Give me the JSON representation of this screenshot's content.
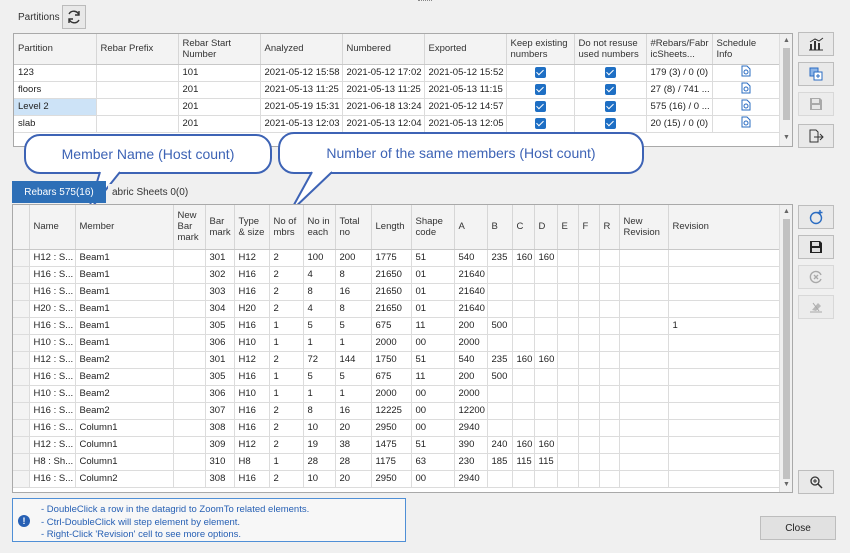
{
  "header": {
    "title": "Partitions"
  },
  "partitions": {
    "columns": [
      "Partition",
      "Rebar Prefix",
      "Rebar Start Number",
      "Analyzed",
      "Numbered",
      "Exported",
      "Keep existing numbers",
      "Do not resuse used numbers",
      "#Rebars/Fabr icSheets...",
      "Schedule Info"
    ],
    "rows": [
      {
        "partition": "123",
        "prefix": "",
        "start": "101",
        "analyzed": "2021-05-12 15:58",
        "numbered": "2021-05-12 17:02",
        "exported": "2021-05-12 15:52",
        "keep": true,
        "noreuse": true,
        "count": "179 (3) / 0 (0)"
      },
      {
        "partition": "floors",
        "prefix": "",
        "start": "201",
        "analyzed": "2021-05-13 11:25",
        "numbered": "2021-05-13 11:25",
        "exported": "2021-05-13 11:15",
        "keep": true,
        "noreuse": true,
        "count": "27 (8) / 741 ..."
      },
      {
        "partition": "Level 2",
        "prefix": "",
        "start": "201",
        "analyzed": "2021-05-19 15:31",
        "numbered": "2021-06-18 13:24",
        "exported": "2021-05-12 14:57",
        "keep": true,
        "noreuse": true,
        "count": "575 (16) / 0 ..."
      },
      {
        "partition": "slab",
        "prefix": "",
        "start": "201",
        "analyzed": "2021-05-13 12:03",
        "numbered": "2021-05-13 12:04",
        "exported": "2021-05-13 12:05",
        "keep": true,
        "noreuse": true,
        "count": "20 (15) / 0 (0)"
      }
    ]
  },
  "callouts": {
    "member_name": "Member Name (Host count)",
    "same_members": "Number of the same members (Host count)"
  },
  "tabs": {
    "rebars": "Rebars 575(16)",
    "fabric": "abric Sheets 0(0)"
  },
  "rebars": {
    "columns": [
      "Name",
      "Member",
      "New Bar mark",
      "Bar mark",
      "Type & size",
      "No of mbrs",
      "No in each",
      "Total no",
      "Length",
      "Shape code",
      "A",
      "B",
      "C",
      "D",
      "E",
      "F",
      "R",
      "New Revision",
      "Revision"
    ],
    "rows": [
      [
        "H12 : S...",
        "Beam1",
        "",
        "301",
        "H12",
        "2",
        "100",
        "200",
        "1775",
        "51",
        "540",
        "235",
        "160",
        "160",
        "",
        "",
        "",
        "",
        ""
      ],
      [
        "H16 : S...",
        "Beam1",
        "",
        "302",
        "H16",
        "2",
        "4",
        "8",
        "21650",
        "01",
        "21640",
        "",
        "",
        "",
        "",
        "",
        "",
        "",
        ""
      ],
      [
        "H16 : S...",
        "Beam1",
        "",
        "303",
        "H16",
        "2",
        "8",
        "16",
        "21650",
        "01",
        "21640",
        "",
        "",
        "",
        "",
        "",
        "",
        "",
        ""
      ],
      [
        "H20 : S...",
        "Beam1",
        "",
        "304",
        "H20",
        "2",
        "4",
        "8",
        "21650",
        "01",
        "21640",
        "",
        "",
        "",
        "",
        "",
        "",
        "",
        ""
      ],
      [
        "H16 : S...",
        "Beam1",
        "",
        "305",
        "H16",
        "1",
        "5",
        "5",
        "675",
        "11",
        "200",
        "500",
        "",
        "",
        "",
        "",
        "",
        "",
        "1"
      ],
      [
        "H10 : S...",
        "Beam1",
        "",
        "306",
        "H10",
        "1",
        "1",
        "1",
        "2000",
        "00",
        "2000",
        "",
        "",
        "",
        "",
        "",
        "",
        "",
        ""
      ],
      [
        "H12 : S...",
        "Beam2",
        "",
        "301",
        "H12",
        "2",
        "72",
        "144",
        "1750",
        "51",
        "540",
        "235",
        "160",
        "160",
        "",
        "",
        "",
        "",
        ""
      ],
      [
        "H16 : S...",
        "Beam2",
        "",
        "305",
        "H16",
        "1",
        "5",
        "5",
        "675",
        "11",
        "200",
        "500",
        "",
        "",
        "",
        "",
        "",
        "",
        ""
      ],
      [
        "H10 : S...",
        "Beam2",
        "",
        "306",
        "H10",
        "1",
        "1",
        "1",
        "2000",
        "00",
        "2000",
        "",
        "",
        "",
        "",
        "",
        "",
        "",
        ""
      ],
      [
        "H16 : S...",
        "Beam2",
        "",
        "307",
        "H16",
        "2",
        "8",
        "16",
        "12225",
        "00",
        "12200",
        "",
        "",
        "",
        "",
        "",
        "",
        "",
        ""
      ],
      [
        "H16 : S...",
        "Column1",
        "",
        "308",
        "H16",
        "2",
        "10",
        "20",
        "2950",
        "00",
        "2940",
        "",
        "",
        "",
        "",
        "",
        "",
        "",
        ""
      ],
      [
        "H12 : S...",
        "Column1",
        "",
        "309",
        "H12",
        "2",
        "19",
        "38",
        "1475",
        "51",
        "390",
        "240",
        "160",
        "160",
        "",
        "",
        "",
        "",
        ""
      ],
      [
        "H8 : Sh...",
        "Column1",
        "",
        "310",
        "H8",
        "1",
        "28",
        "28",
        "1175",
        "63",
        "230",
        "185",
        "115",
        "115",
        "",
        "",
        "",
        "",
        ""
      ],
      [
        "H16 : S...",
        "Column2",
        "",
        "308",
        "H16",
        "2",
        "10",
        "20",
        "2950",
        "00",
        "2940",
        "",
        "",
        "",
        "",
        "",
        "",
        "",
        ""
      ]
    ]
  },
  "info": {
    "line1": "- DoubleClick a row in the datagrid to ZoomTo related elements.",
    "line2": "- Ctrl-DoubleClick will step element by element.",
    "line3": "- Right-Click 'Revision' cell to see more options."
  },
  "footer": {
    "close_label": "Close"
  }
}
